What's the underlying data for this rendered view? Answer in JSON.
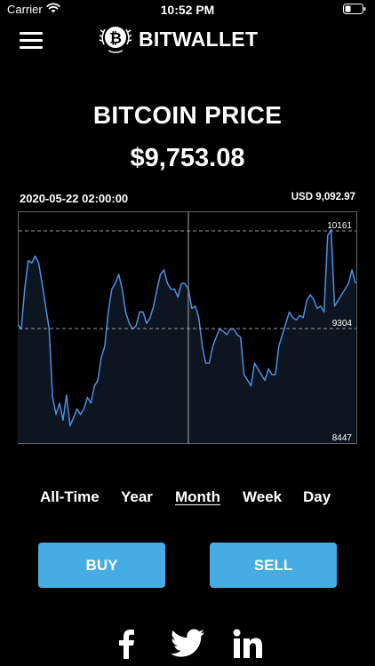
{
  "status_bar": {
    "carrier": "Carrier",
    "time": "10:52 PM"
  },
  "nav": {
    "logo_text": "BITWALLET",
    "logo_icon": "bitcoin-icon"
  },
  "header": {
    "title": "BITCOIN PRICE",
    "price": "$9,753.08"
  },
  "chart_header": {
    "timestamp": "2020-05-22 02:00:00",
    "hover_value": "USD 9,092.97"
  },
  "chart_data": {
    "type": "area",
    "y_ticks": [
      "10161",
      "9304",
      "8447"
    ],
    "ylim": [
      8447,
      10161
    ],
    "grid": true,
    "color_line": "#4a90e2",
    "color_fill": "#0d1520",
    "values": [
      9340,
      9300,
      9650,
      9900,
      9880,
      9940,
      9880,
      9700,
      9500,
      9300,
      8700,
      8550,
      8650,
      8500,
      8720,
      8450,
      8520,
      8600,
      8550,
      8600,
      8700,
      8650,
      8800,
      8850,
      9050,
      9150,
      9450,
      9650,
      9700,
      9780,
      9650,
      9450,
      9350,
      9300,
      9330,
      9450,
      9450,
      9350,
      9400,
      9500,
      9650,
      9780,
      9820,
      9700,
      9650,
      9650,
      9580,
      9700,
      9700,
      9650,
      9480,
      9500,
      9400,
      9150,
      9000,
      9000,
      9150,
      9230,
      9300,
      9280,
      9250,
      9300,
      9300,
      9250,
      9230,
      8900,
      8850,
      8800,
      9000,
      8950,
      8900,
      8850,
      8950,
      8900,
      8900,
      9150,
      9250,
      9350,
      9450,
      9400,
      9380,
      9420,
      9400,
      9550,
      9600,
      9560,
      9480,
      9500,
      9450,
      10120,
      10170,
      9500,
      9550,
      9600,
      9650,
      9700,
      9820,
      9700
    ],
    "crosshair_index": 49
  },
  "ranges": {
    "items": [
      "All-Time",
      "Year",
      "Month",
      "Week",
      "Day"
    ],
    "active": "Month"
  },
  "actions": {
    "buy_label": "BUY",
    "sell_label": "SELL",
    "accent": "#45ade3"
  },
  "social": {
    "icons": [
      "facebook-icon",
      "twitter-icon",
      "linkedin-icon"
    ]
  }
}
